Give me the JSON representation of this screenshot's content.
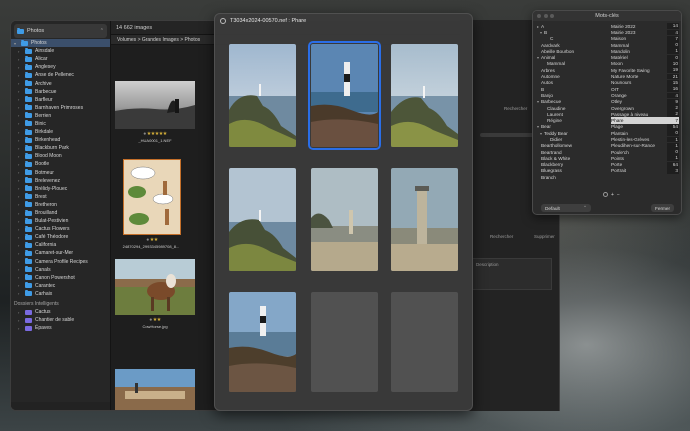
{
  "sidebar": {
    "source_label": "Photos",
    "root_folder": "Photos",
    "folders": [
      "Ainsdale",
      "Alicar",
      "Anglesey",
      "Anse de Pellenec",
      "Archive",
      "Barbecue",
      "Barfleur",
      "Barnhaven Primroses",
      "Berrien",
      "Binic",
      "Birkdale",
      "Birkenhead",
      "Blackburn Park",
      "Blood Moon",
      "Bootle",
      "Botmeur",
      "Brelevenez",
      "Brélidy-Plouec",
      "Brest",
      "Bretheron",
      "Brouilland",
      "Bulat-Pestivien",
      "Cactus Flowers",
      "Café Théodore",
      "California",
      "Camaret-sur-Mer",
      "Camera Profile Recipes",
      "Canals",
      "Canon Powershot",
      "Carantec",
      "Carhaix"
    ],
    "smart_folders_title": "Dossiers Intelligents",
    "smart_folders": [
      "Cactus",
      "Chantier de sable",
      "Épaves"
    ]
  },
  "browser": {
    "count_label": "14 662 images",
    "breadcrumb": "Volumes > Grandes Images > Photos",
    "thumbnails": [
      {
        "caption": "_HUA0001_1.NEF",
        "rating": 5
      },
      {
        "caption": "24870294_2993345989708_8...",
        "rating": 2
      },
      {
        "caption": "CowHorse.jpg",
        "rating": 2
      },
      {
        "caption": "",
        "rating": 0
      }
    ]
  },
  "inspector": {
    "labels": [
      "Rechercher",
      "Supprimer",
      "Rechercher",
      "Supprimer",
      "Description"
    ]
  },
  "quicklook": {
    "title": "T3034x2024-00570.nef : Phare"
  },
  "keywords_panel": {
    "title": "Mots-clés",
    "left": [
      {
        "label": "A",
        "indent": 0,
        "chev": "▸"
      },
      {
        "label": "B",
        "indent": 1,
        "chev": "▾"
      },
      {
        "label": "C",
        "indent": 3,
        "chev": ""
      },
      {
        "label": "Aardvark",
        "indent": 0,
        "chev": ""
      },
      {
        "label": "Abeille Bourbon",
        "indent": 0,
        "chev": ""
      },
      {
        "label": "Animal",
        "indent": 0,
        "chev": "▾"
      },
      {
        "label": "Mammal",
        "indent": 2,
        "chev": ""
      },
      {
        "label": "Arbres",
        "indent": 0,
        "chev": ""
      },
      {
        "label": "Automne",
        "indent": 0,
        "chev": ""
      },
      {
        "label": "Autos",
        "indent": 0,
        "chev": ""
      },
      {
        "label": "B",
        "indent": 0,
        "chev": ""
      },
      {
        "label": "Banjo",
        "indent": 0,
        "chev": ""
      },
      {
        "label": "Barbecue",
        "indent": 0,
        "chev": "▾"
      },
      {
        "label": "Claudine",
        "indent": 2,
        "chev": ""
      },
      {
        "label": "Laurent",
        "indent": 2,
        "chev": ""
      },
      {
        "label": "Régine",
        "indent": 2,
        "chev": ""
      },
      {
        "label": "Bear",
        "indent": 0,
        "chev": "▾"
      },
      {
        "label": "Teddy Bear",
        "indent": 1,
        "chev": "▾"
      },
      {
        "label": "Didier",
        "indent": 3,
        "chev": ""
      },
      {
        "label": "Bearthollomew",
        "indent": 0,
        "chev": ""
      },
      {
        "label": "Beartrand",
        "indent": 0,
        "chev": ""
      },
      {
        "label": "Black & White",
        "indent": 0,
        "chev": ""
      },
      {
        "label": "Blackberry",
        "indent": 0,
        "chev": ""
      },
      {
        "label": "Bluegrass",
        "indent": 0,
        "chev": ""
      },
      {
        "label": "Branch",
        "indent": 0,
        "chev": ""
      }
    ],
    "right": [
      {
        "label": "Mairie 2022",
        "count": "14"
      },
      {
        "label": "Mairie 2023",
        "count": "4"
      },
      {
        "label": "Maison",
        "count": "7"
      },
      {
        "label": "Mammal",
        "count": "0"
      },
      {
        "label": "Mandolin",
        "count": "1"
      },
      {
        "label": "Matériel",
        "count": "0"
      },
      {
        "label": "Moon",
        "count": "10"
      },
      {
        "label": "My Favorite Swing",
        "count": "19"
      },
      {
        "label": "Nature Morte",
        "count": "21"
      },
      {
        "label": "Nounours",
        "count": "15"
      },
      {
        "label": "OIT",
        "count": "16"
      },
      {
        "label": "Orange",
        "count": "4"
      },
      {
        "label": "Otley",
        "count": "9"
      },
      {
        "label": "Overgrown",
        "count": "2"
      },
      {
        "label": "Passage à niveau",
        "count": "2"
      },
      {
        "label": "Phare",
        "count": "7"
      },
      {
        "label": "Plage",
        "count": "54"
      },
      {
        "label": "Plantain",
        "count": "0"
      },
      {
        "label": "Plestin-les-Grèves",
        "count": "1"
      },
      {
        "label": "Pleudihen-sur-Rance",
        "count": "1"
      },
      {
        "label": "Poule'ch",
        "count": "0"
      },
      {
        "label": "Points",
        "count": "1"
      },
      {
        "label": "Porte",
        "count": "64"
      },
      {
        "label": "Portrait",
        "count": "3"
      }
    ],
    "selected_keyword": "Phare",
    "preset_label": "Default",
    "close_label": "Fermer",
    "add_label": "+",
    "remove_label": "−"
  }
}
